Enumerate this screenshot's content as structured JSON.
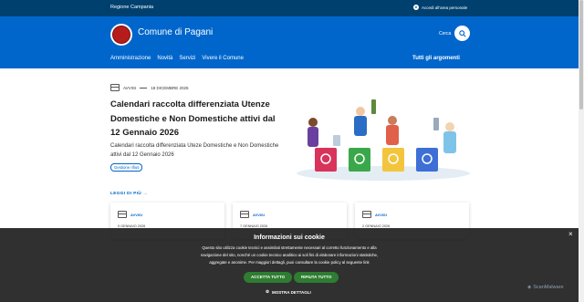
{
  "topbar": {
    "region": "Regione Campania",
    "login": "Accedi all'area personale"
  },
  "header": {
    "site_title": "Comune di Pagani",
    "search_label": "Cerca",
    "nav": [
      "Amministrazione",
      "Novità",
      "Servizi",
      "Vivere il Comune"
    ],
    "all_topics": "Tutti gli argomenti"
  },
  "hero": {
    "category": "AVVISI",
    "date": "18 DICEMBRE 2025",
    "title": "Calendari raccolta differenziata Utenze Domestiche e Non Domestiche attivi dal 12 Gennaio 2026",
    "description": "Calendari raccolta differenziata Uteze Domestiche e Non Domestiche attivi dal 12 Gennaio 2026",
    "tag": "Gestione rifiuti"
  },
  "leggi_di_piu": "LEGGI DI PIÙ",
  "cards": [
    {
      "category": "AVVISI",
      "date": "9 GENNAIO 2026"
    },
    {
      "category": "AVVISI",
      "date": "7 GENNAIO 2026"
    },
    {
      "category": "AVVISI",
      "date": "2 GENNAIO 2026"
    }
  ],
  "cookie": {
    "title": "Informazioni sui cookie",
    "text": "Questo sito utilizza cookie tecnici e assimilati strettamente necessari al corretto funzionamento e alla navigazione del sito, nonché un cookie tecnico analitico ai soli fini di elaborare informazioni statistiche, aggregate e anonime. Per maggiori dettagli, puoi consultare la cookie policy al seguente link",
    "accept": "ACCETTA TUTTO",
    "reject": "RIFIUTA TUTTO",
    "details": "MOSTRA DETTAGLI",
    "close": "×"
  },
  "watermark": "ScanMalware",
  "colors": {
    "top_bar": "#00406f",
    "header": "#0066cc",
    "accent": "#0066cc",
    "cookie_button": "#2e7d32"
  }
}
